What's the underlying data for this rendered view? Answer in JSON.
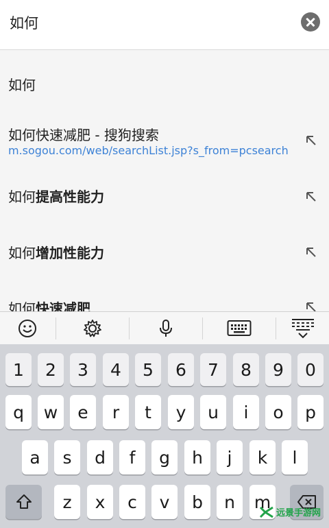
{
  "search": {
    "query": "如何"
  },
  "suggestions": [
    {
      "plain": "如何",
      "bold": "",
      "url": ""
    },
    {
      "plain": "如何快速减肥 - 搜狗搜索",
      "bold": "",
      "url": "m.sogou.com/web/searchList.jsp?s_from=pcsearch"
    },
    {
      "plain": "如何",
      "bold": "提高性能力",
      "url": ""
    },
    {
      "plain": "如何",
      "bold": "增加性能力",
      "url": ""
    },
    {
      "plain": "如何",
      "bold": "快速减肥",
      "url": ""
    }
  ],
  "keyboard": {
    "toolbar_icons": [
      "emoji-icon",
      "settings-gear-icon",
      "microphone-icon",
      "keyboard-icon",
      "keyboard-hide-icon"
    ],
    "row_numbers": [
      "1",
      "2",
      "3",
      "4",
      "5",
      "6",
      "7",
      "8",
      "9",
      "0"
    ],
    "row1": [
      "q",
      "w",
      "e",
      "r",
      "t",
      "y",
      "u",
      "i",
      "o",
      "p"
    ],
    "row2": [
      "a",
      "s",
      "d",
      "f",
      "g",
      "h",
      "j",
      "k",
      "l"
    ],
    "row3": [
      "z",
      "x",
      "c",
      "v",
      "b",
      "n",
      "m"
    ],
    "shift_icon": "shift-arrow-icon",
    "backspace_icon": "backspace-icon"
  },
  "watermark": {
    "text": "远景手游网"
  },
  "colors": {
    "link": "#3d82d6",
    "watermark": "#22a34a"
  }
}
